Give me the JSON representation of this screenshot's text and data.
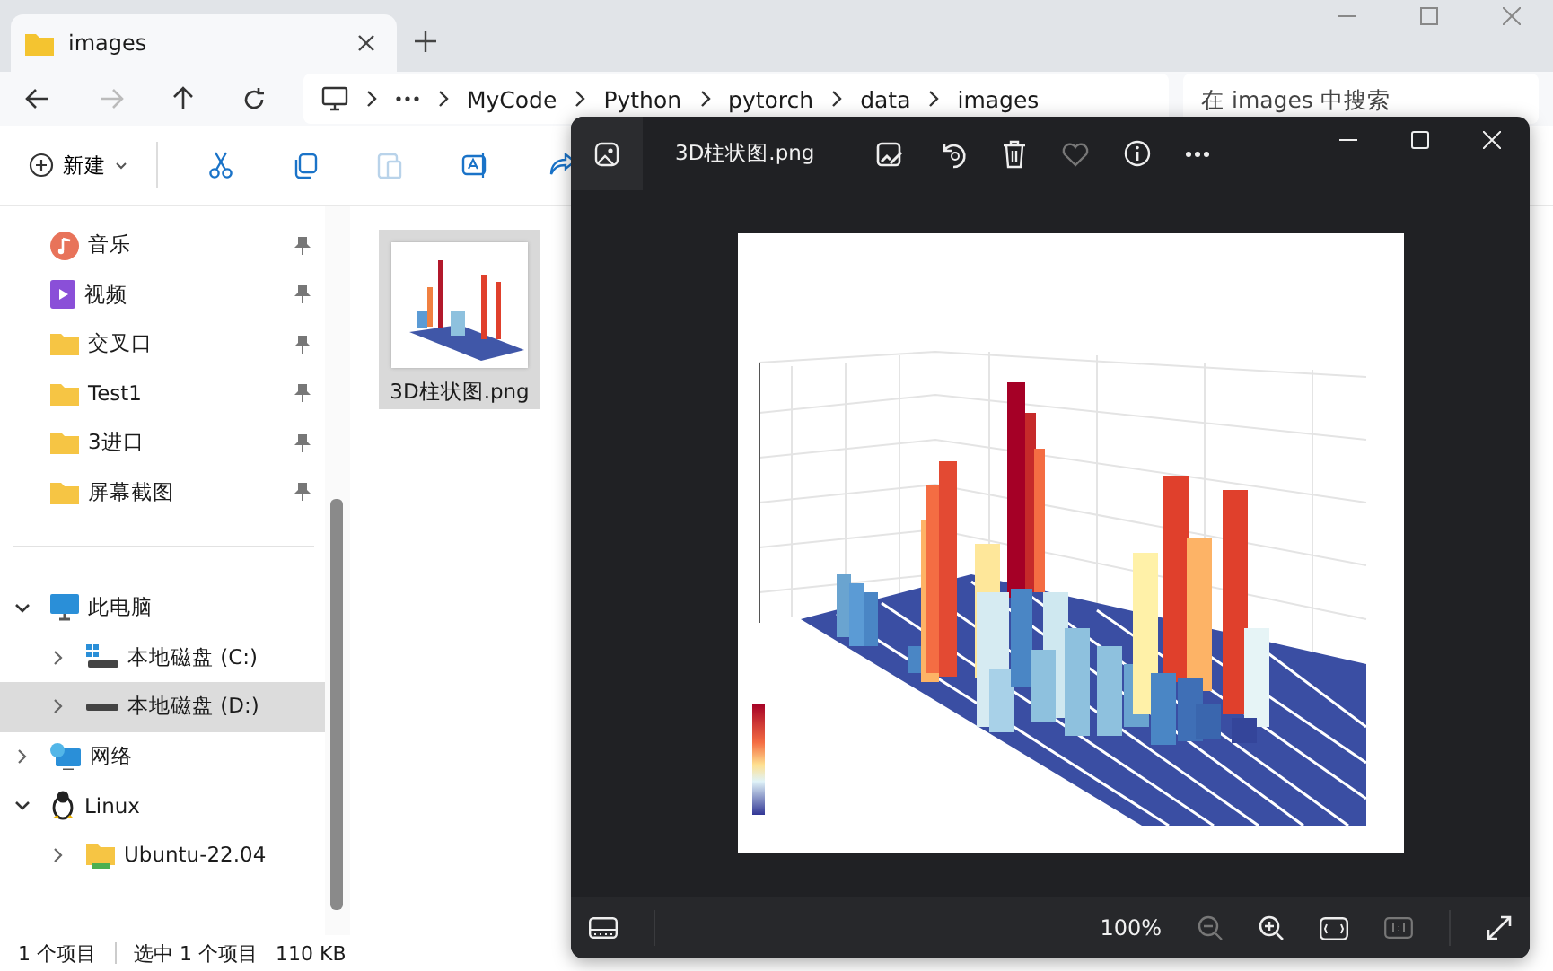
{
  "explorer": {
    "tabs": [
      {
        "label": "images",
        "selected": true
      }
    ],
    "address": {
      "crumbs": [
        "MyCode",
        "Python",
        "pytorch",
        "data",
        "images"
      ]
    },
    "search": {
      "placeholder": "在 images 中搜索"
    },
    "toolbar": {
      "new_label": "新建"
    },
    "quick_access": [
      {
        "label": "音乐",
        "kind": "music",
        "pinned": true
      },
      {
        "label": "视频",
        "kind": "video",
        "pinned": true
      },
      {
        "label": "交叉口",
        "kind": "folder",
        "pinned": true
      },
      {
        "label": "Test1",
        "kind": "folder",
        "pinned": true
      },
      {
        "label": "3进口",
        "kind": "folder",
        "pinned": true
      },
      {
        "label": "屏幕截图",
        "kind": "folder",
        "pinned": true
      }
    ],
    "tree": [
      {
        "label": "此电脑",
        "kind": "pc",
        "expanded": true,
        "selected": false,
        "children": [
          {
            "label": "本地磁盘 (C:)",
            "kind": "system-drive",
            "expanded": false,
            "selected": false
          },
          {
            "label": "本地磁盘 (D:)",
            "kind": "drive",
            "expanded": false,
            "selected": true
          }
        ]
      },
      {
        "label": "网络",
        "kind": "network",
        "expanded": false,
        "selected": false
      },
      {
        "label": "Linux",
        "kind": "linux",
        "expanded": true,
        "selected": false,
        "children": [
          {
            "label": "Ubuntu-22.04",
            "kind": "distro",
            "expanded": false,
            "selected": false
          }
        ]
      }
    ],
    "files": [
      {
        "name": "3D柱状图.png",
        "selected": true
      }
    ],
    "status_bar": {
      "count": "1 个项目",
      "selection": "选中 1 个项目",
      "size": "110 KB"
    }
  },
  "viewer": {
    "title": "3D柱状图.png",
    "zoom": "100%"
  }
}
